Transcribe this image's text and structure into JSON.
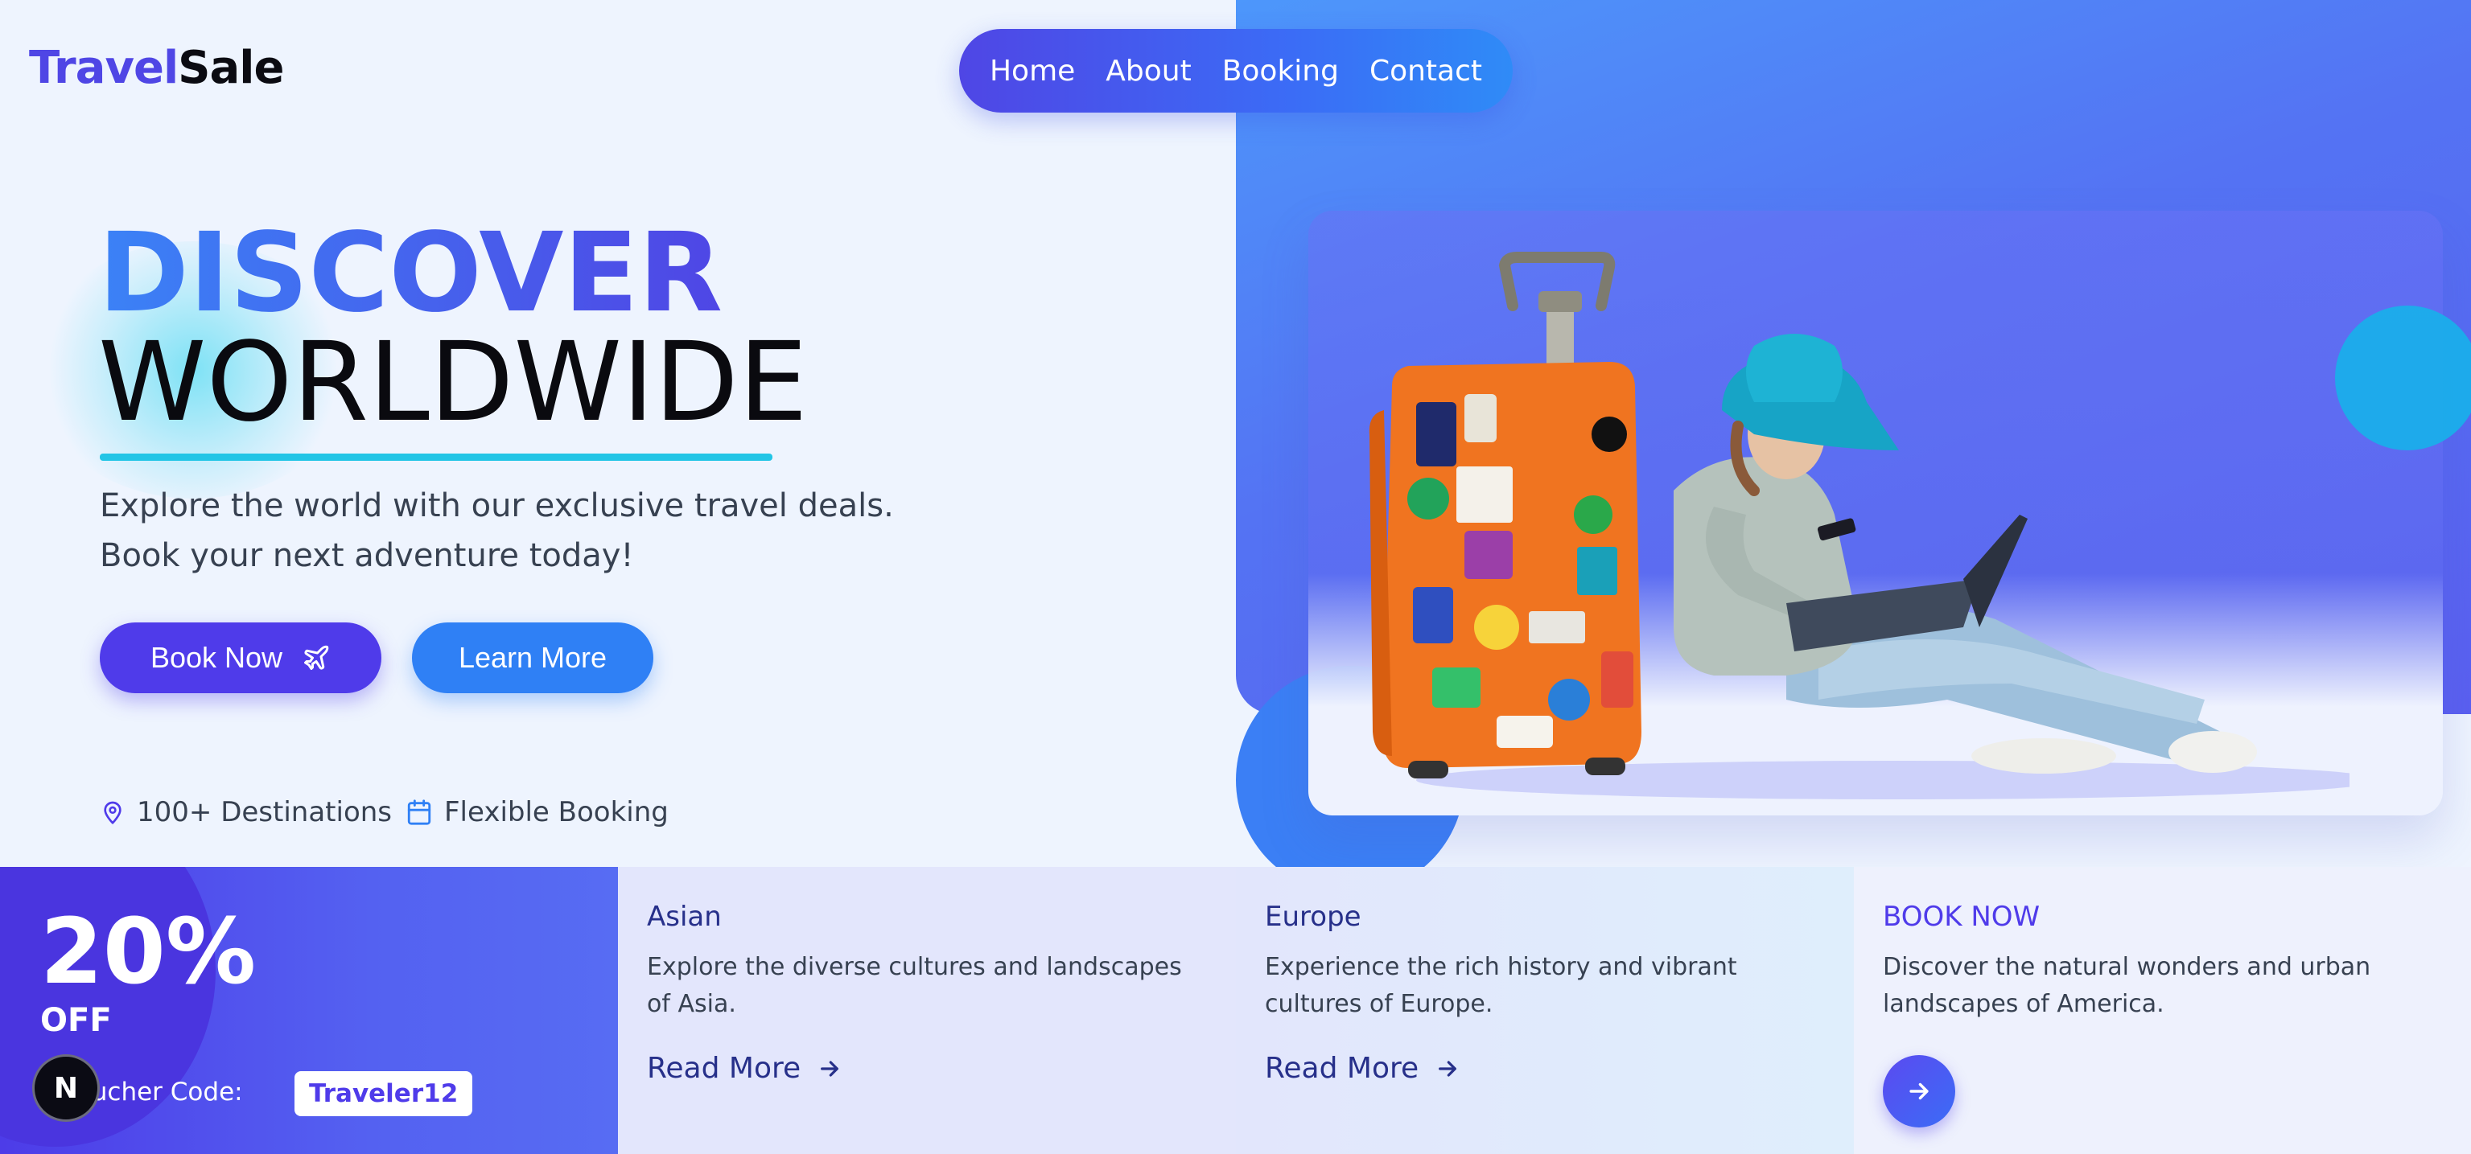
{
  "brand": {
    "part1": "Travel",
    "part2": "Sale"
  },
  "nav": {
    "items": [
      "Home",
      "About",
      "Booking",
      "Contact"
    ]
  },
  "hero": {
    "title_line1": "DISCOVER",
    "title_line2": "WORLDWIDE",
    "subtitle": "Explore the world with our exclusive travel deals. Book your next adventure today!",
    "book_label": "Book Now",
    "learn_label": "Learn More",
    "features": [
      {
        "icon": "map-pin-icon",
        "label": "100+ Destinations"
      },
      {
        "icon": "calendar-icon",
        "label": "Flexible Booking"
      }
    ],
    "image_alt": "Traveler with sticker-covered orange suitcase and laptop"
  },
  "promo": {
    "percent": "20%",
    "off": "OFF",
    "voucher_label": "Voucher Code:",
    "voucher_code": "Traveler12",
    "badge": "N"
  },
  "cards": [
    {
      "title": "Asian",
      "desc": "Explore the diverse cultures and landscapes of Asia.",
      "link": "Read More"
    },
    {
      "title": "Europe",
      "desc": "Experience the rich history and vibrant cultures of Europe.",
      "link": "Read More"
    },
    {
      "title": "BOOK NOW",
      "desc": "Discover the natural wonders and urban landscapes of America."
    }
  ],
  "colors": {
    "primary": "#4f3bea",
    "accent": "#22c5e6",
    "secondary": "#2f80f5",
    "background": "#eef4fe"
  }
}
